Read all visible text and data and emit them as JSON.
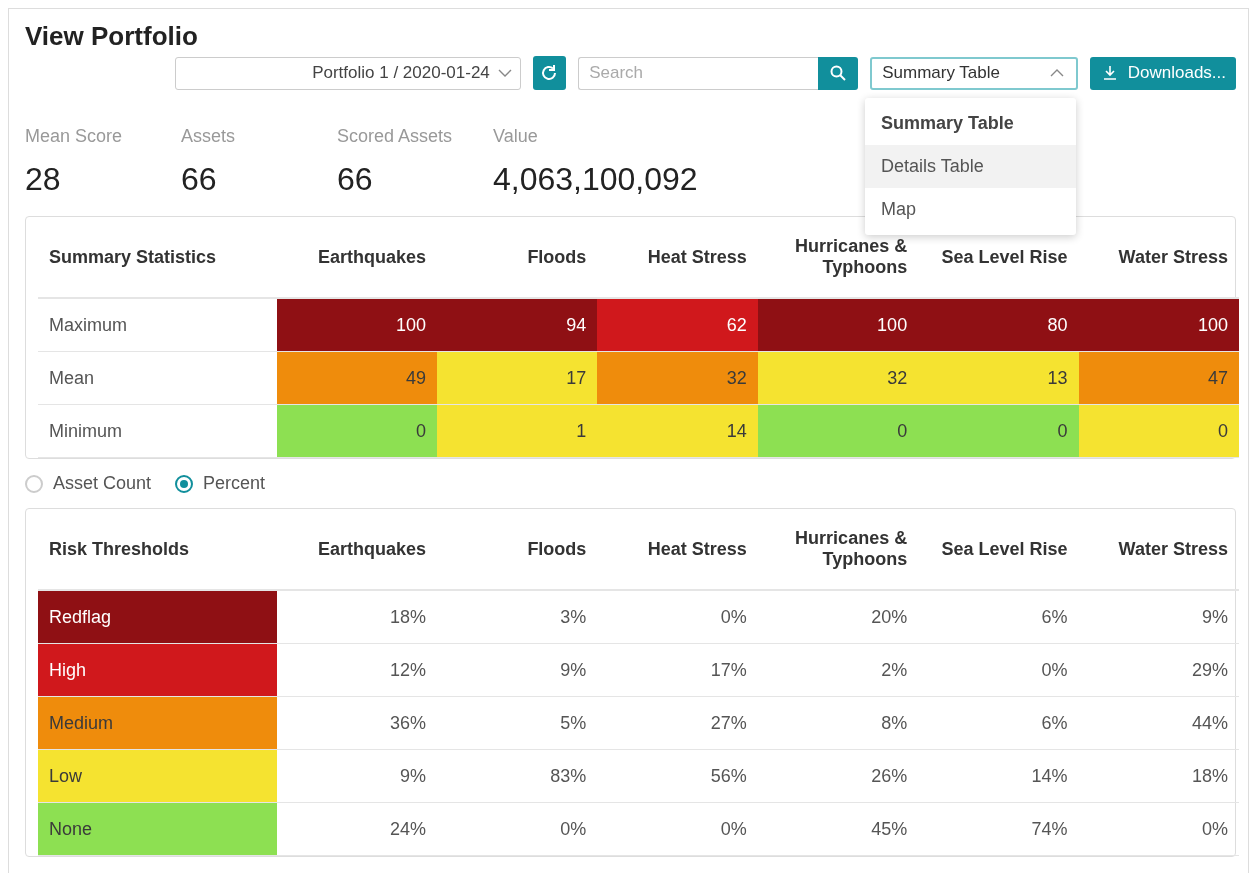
{
  "title": "View Portfolio",
  "toolbar": {
    "portfolio": "Portfolio 1 / 2020-01-24",
    "search_placeholder": "Search",
    "view_select": "Summary Table",
    "view_expanded": true,
    "downloads": "Downloads..."
  },
  "view_menu": [
    {
      "label": "Summary Table",
      "selected": true,
      "hovered": false
    },
    {
      "label": "Details Table",
      "selected": false,
      "hovered": true
    },
    {
      "label": "Map",
      "selected": false,
      "hovered": false
    }
  ],
  "stats": [
    {
      "label": "Mean Score",
      "value": "28"
    },
    {
      "label": "Assets",
      "value": "66"
    },
    {
      "label": "Scored Assets",
      "value": "66"
    },
    {
      "label": "Value",
      "value": "4,063,100,092"
    }
  ],
  "summary_table": {
    "columns": [
      "Summary Statistics",
      "Earthquakes",
      "Floods",
      "Heat Stress",
      "Hurricanes & Typhoons",
      "Sea Level Rise",
      "Water Stress"
    ],
    "rows": [
      [
        {
          "value": "Maximum"
        },
        {
          "value": "100",
          "color": "#8f1014"
        },
        {
          "value": "94",
          "color": "#8f1014"
        },
        {
          "value": "62",
          "color": "#d0181c"
        },
        {
          "value": "100",
          "color": "#8f1014"
        },
        {
          "value": "80",
          "color": "#8f1014"
        },
        {
          "value": "100",
          "color": "#8f1014"
        }
      ],
      [
        {
          "value": "Mean"
        },
        {
          "value": "49",
          "color": "#ef8c0c"
        },
        {
          "value": "17",
          "color": "#f5e330"
        },
        {
          "value": "32",
          "color": "#ef8c0c"
        },
        {
          "value": "32",
          "color": "#f5e330"
        },
        {
          "value": "13",
          "color": "#f5e330"
        },
        {
          "value": "47",
          "color": "#ef8c0c"
        }
      ],
      [
        {
          "value": "Minimum"
        },
        {
          "value": "0",
          "color": "#8de052"
        },
        {
          "value": "1",
          "color": "#f5e330"
        },
        {
          "value": "14",
          "color": "#f5e330"
        },
        {
          "value": "0",
          "color": "#8de052"
        },
        {
          "value": "0",
          "color": "#8de052"
        },
        {
          "value": "0",
          "color": "#f5e330"
        }
      ]
    ]
  },
  "display_mode": [
    {
      "label": "Asset Count",
      "selected": false
    },
    {
      "label": "Percent",
      "selected": true
    }
  ],
  "thresholds_table": {
    "columns": [
      "Risk Thresholds",
      "Earthquakes",
      "Floods",
      "Heat Stress",
      "Hurricanes & Typhoons",
      "Sea Level Rise",
      "Water Stress"
    ],
    "rows": [
      [
        {
          "value": "Redflag",
          "color": "#8f1014"
        },
        {
          "value": "18%"
        },
        {
          "value": "3%"
        },
        {
          "value": "0%"
        },
        {
          "value": "20%"
        },
        {
          "value": "6%"
        },
        {
          "value": "9%"
        }
      ],
      [
        {
          "value": "High",
          "color": "#d0181c"
        },
        {
          "value": "12%"
        },
        {
          "value": "9%"
        },
        {
          "value": "17%"
        },
        {
          "value": "2%"
        },
        {
          "value": "0%"
        },
        {
          "value": "29%"
        }
      ],
      [
        {
          "value": "Medium",
          "color": "#ef8c0c"
        },
        {
          "value": "36%"
        },
        {
          "value": "5%"
        },
        {
          "value": "27%"
        },
        {
          "value": "8%"
        },
        {
          "value": "6%"
        },
        {
          "value": "44%"
        }
      ],
      [
        {
          "value": "Low",
          "color": "#f5e330"
        },
        {
          "value": "9%"
        },
        {
          "value": "83%"
        },
        {
          "value": "56%"
        },
        {
          "value": "26%"
        },
        {
          "value": "14%"
        },
        {
          "value": "18%"
        }
      ],
      [
        {
          "value": "None",
          "color": "#8de052"
        },
        {
          "value": "24%"
        },
        {
          "value": "0%"
        },
        {
          "value": "0%"
        },
        {
          "value": "45%"
        },
        {
          "value": "74%"
        },
        {
          "value": "0%"
        }
      ]
    ]
  }
}
